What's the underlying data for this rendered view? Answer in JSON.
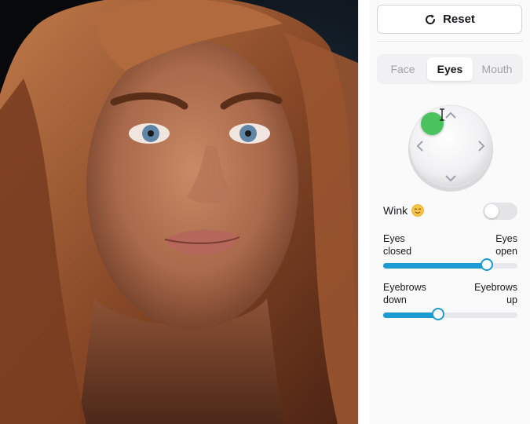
{
  "reset": {
    "label": "Reset",
    "icon": "rotate-cw-icon"
  },
  "tabs": [
    {
      "label": "Face",
      "active": false
    },
    {
      "label": "Eyes",
      "active": true
    },
    {
      "label": "Mouth",
      "active": false
    }
  ],
  "joystick": {
    "handle_color": "#4ac35f",
    "arrows": [
      "up",
      "left",
      "right",
      "down"
    ]
  },
  "wink": {
    "label": "Wink",
    "emoji": "winking-face-emoji",
    "enabled": false
  },
  "sliders": [
    {
      "id": "eyes",
      "min_label": "Eyes\nclosed",
      "max_label": "Eyes\nopen",
      "value": 0.77
    },
    {
      "id": "eyebrows",
      "min_label": "Eyebrows\ndown",
      "max_label": "Eyebrows\nup",
      "value": 0.41
    }
  ],
  "colors": {
    "accent": "#1b9bd1",
    "toggle_off": "#e4e4e7"
  }
}
